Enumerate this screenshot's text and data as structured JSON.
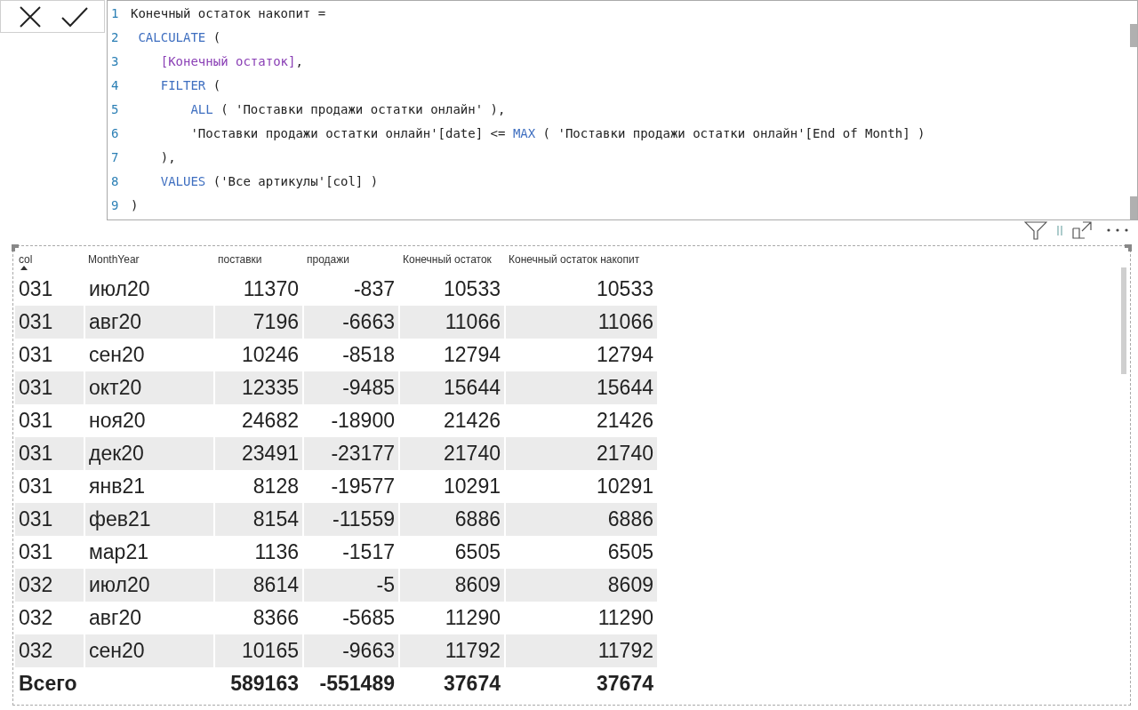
{
  "formula_bar": {
    "lines": [
      {
        "number": "1",
        "segments": [
          {
            "kind": "text",
            "text": "Конечный остаток накопит ="
          }
        ]
      },
      {
        "number": "2",
        "segments": [
          {
            "kind": "keyword",
            "text": " CALCULATE"
          },
          {
            "kind": "text",
            "text": " ("
          }
        ]
      },
      {
        "number": "3",
        "segments": [
          {
            "kind": "measure",
            "text": "    [Конечный остаток]"
          },
          {
            "kind": "text",
            "text": ","
          }
        ]
      },
      {
        "number": "4",
        "segments": [
          {
            "kind": "keyword",
            "text": "    FILTER"
          },
          {
            "kind": "text",
            "text": " ("
          }
        ]
      },
      {
        "number": "5",
        "segments": [
          {
            "kind": "keyword",
            "text": "        ALL"
          },
          {
            "kind": "text",
            "text": " ( 'Поставки продажи остатки онлайн' ),"
          }
        ]
      },
      {
        "number": "6",
        "segments": [
          {
            "kind": "text",
            "text": "        'Поставки продажи остатки онлайн'[date] <= "
          },
          {
            "kind": "keyword",
            "text": "MAX"
          },
          {
            "kind": "text",
            "text": " ( 'Поставки продажи остатки онлайн'[End of Month] )"
          }
        ]
      },
      {
        "number": "7",
        "segments": [
          {
            "kind": "text",
            "text": "    ),"
          }
        ]
      },
      {
        "number": "8",
        "segments": [
          {
            "kind": "keyword",
            "text": "    VALUES"
          },
          {
            "kind": "text",
            "text": " ('Все артикулы'[col] )"
          }
        ]
      },
      {
        "number": "9",
        "segments": [
          {
            "kind": "text",
            "text": ")"
          }
        ]
      }
    ]
  },
  "table": {
    "columns": [
      {
        "label": "col",
        "sort_ascending": true
      },
      {
        "label": "MonthYear"
      },
      {
        "label": "поставки"
      },
      {
        "label": "продажи"
      },
      {
        "label": "Конечный остаток"
      },
      {
        "label": "Конечный остаток накопит"
      }
    ],
    "rows": [
      [
        "031",
        "июл20",
        "11370",
        "-837",
        "10533",
        "10533"
      ],
      [
        "031",
        "авг20",
        "7196",
        "-6663",
        "11066",
        "11066"
      ],
      [
        "031",
        "сен20",
        "10246",
        "-8518",
        "12794",
        "12794"
      ],
      [
        "031",
        "окт20",
        "12335",
        "-9485",
        "15644",
        "15644"
      ],
      [
        "031",
        "ноя20",
        "24682",
        "-18900",
        "21426",
        "21426"
      ],
      [
        "031",
        "дек20",
        "23491",
        "-23177",
        "21740",
        "21740"
      ],
      [
        "031",
        "янв21",
        "8128",
        "-19577",
        "10291",
        "10291"
      ],
      [
        "031",
        "фев21",
        "8154",
        "-11559",
        "6886",
        "6886"
      ],
      [
        "031",
        "мар21",
        "1136",
        "-1517",
        "6505",
        "6505"
      ],
      [
        "032",
        "июл20",
        "8614",
        "-5",
        "8609",
        "8609"
      ],
      [
        "032",
        "авг20",
        "8366",
        "-5685",
        "11290",
        "11290"
      ],
      [
        "032",
        "сен20",
        "10165",
        "-9663",
        "11792",
        "11792"
      ]
    ],
    "total": {
      "label": "Всего",
      "values": [
        "589163",
        "-551489",
        "37674",
        "37674"
      ]
    }
  }
}
